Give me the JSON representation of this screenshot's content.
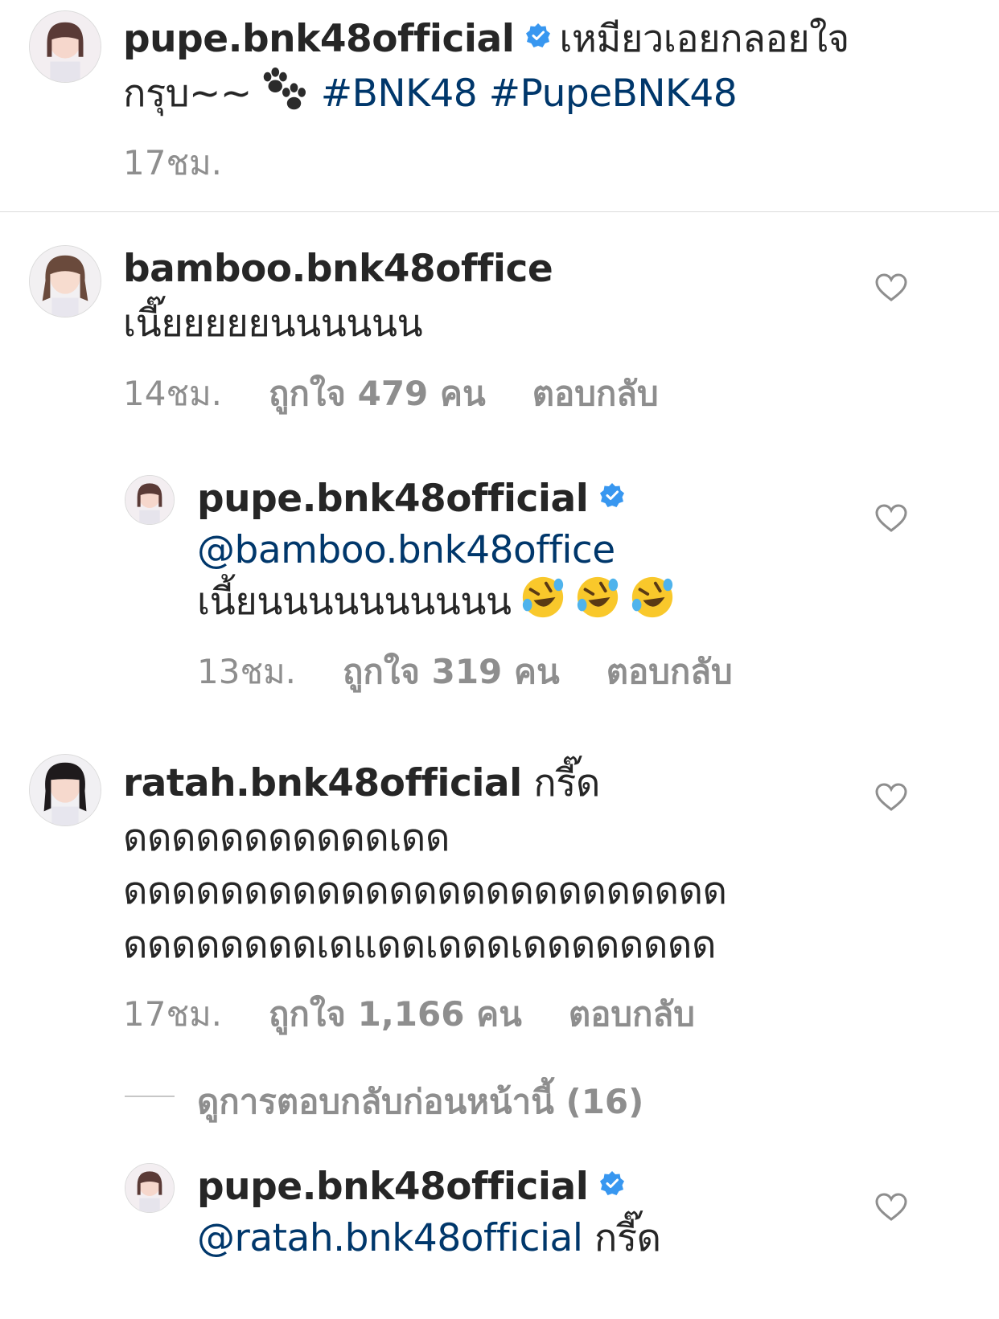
{
  "caption": {
    "username": "pupe.bnk48official",
    "text_line1": "เหมียวเอยกลอยใจ",
    "text_line2": "กรุบ~~",
    "paw_icon": "paw-prints-icon",
    "hashtag1": "#BNK48",
    "hashtag2": "#PupeBNK48",
    "time": "17ชม."
  },
  "comments": [
    {
      "username": "bamboo.bnk48office",
      "text": "เนี๊ยยยยยนนนนนน",
      "time": "14ชม.",
      "likes": "ถูกใจ 479 คน",
      "reply": "ตอบกลับ",
      "replies": [
        {
          "username": "pupe.bnk48official",
          "mention": "@bamboo.bnk48office",
          "text": "เนี้ยนนนนนนนนนน",
          "emoji": "rolling-on-floor-laughing x3",
          "time": "13ชม.",
          "likes": "ถูกใจ 319 คน",
          "reply": "ตอบกลับ"
        }
      ]
    },
    {
      "username": "ratah.bnk48official",
      "text_line1": "กรี๊ด",
      "text_line2": "ดดดดดดดดดดดเดด",
      "text_line3": "ดดดดดดดดดดดดดดดดดดดดดดดดด",
      "text_line4": "ดดดดดดดดเดแดดเดดดเดดดดดดดด",
      "time": "17ชม.",
      "likes": "ถูกใจ 1,166 คน",
      "reply": "ตอบกลับ",
      "view_previous": "ดูการตอบกลับก่อนหน้านี้ (16)",
      "replies": [
        {
          "username": "pupe.bnk48official",
          "mention": "@ratah.bnk48official",
          "text": "กรี๊ด"
        }
      ]
    }
  ],
  "colors": {
    "text": "#262626",
    "muted": "#8e8e8e",
    "link": "#00376b",
    "verified": "#3897f0",
    "divider": "#dbdbdb"
  }
}
